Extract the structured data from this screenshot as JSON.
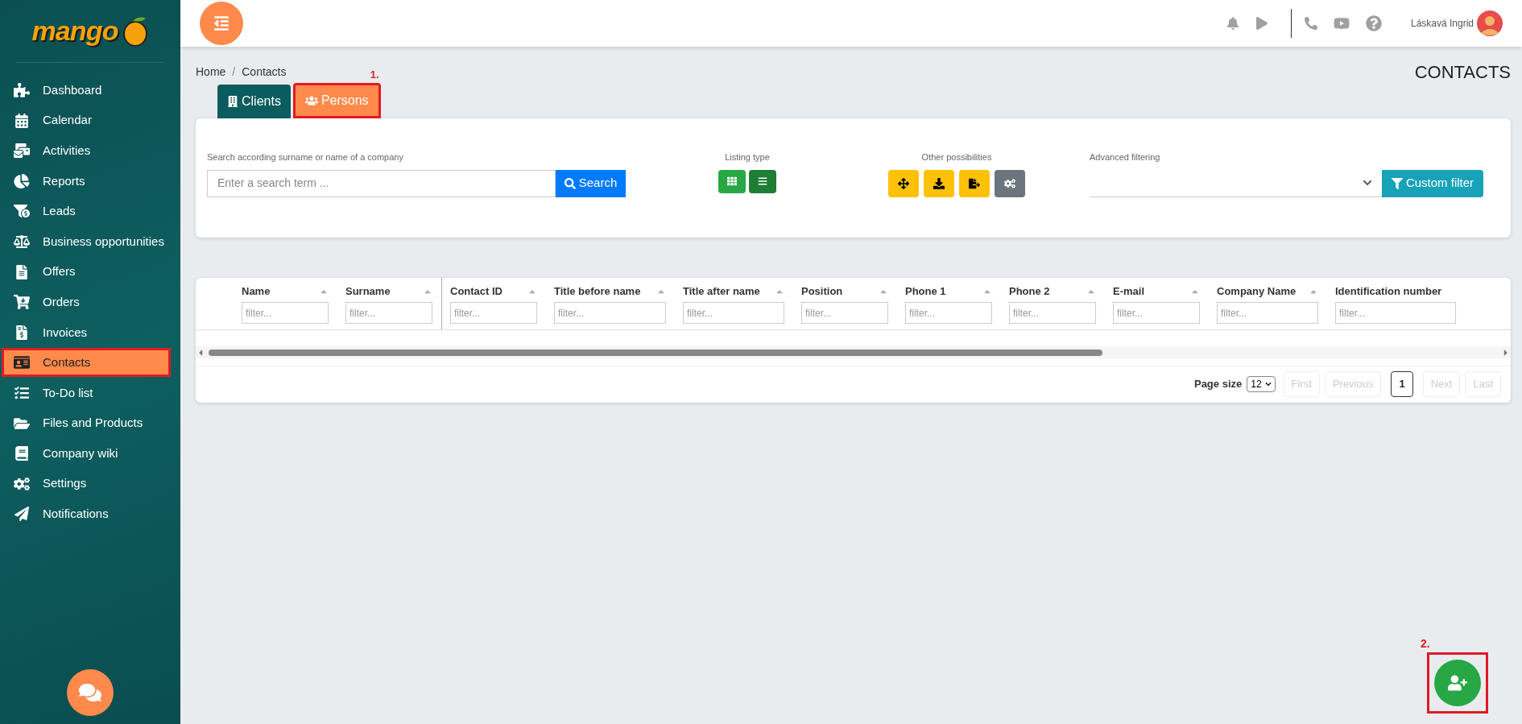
{
  "logo": "mango",
  "sidebar": {
    "items": [
      {
        "label": "Dashboard",
        "selected": false
      },
      {
        "label": "Calendar",
        "selected": false
      },
      {
        "label": "Activities",
        "selected": false
      },
      {
        "label": "Reports",
        "selected": false
      },
      {
        "label": "Leads",
        "selected": false
      },
      {
        "label": "Business opportunities",
        "selected": false
      },
      {
        "label": "Offers",
        "selected": false
      },
      {
        "label": "Orders",
        "selected": false
      },
      {
        "label": "Invoices",
        "selected": false
      },
      {
        "label": "Contacts",
        "selected": true
      },
      {
        "label": "To-Do list",
        "selected": false
      },
      {
        "label": "Files and Products",
        "selected": false
      },
      {
        "label": "Company wiki",
        "selected": false
      },
      {
        "label": "Settings",
        "selected": false
      },
      {
        "label": "Notifications",
        "selected": false
      }
    ]
  },
  "topbar": {
    "user": "Láskavá Ingrid"
  },
  "breadcrumb": [
    "Home",
    "Contacts"
  ],
  "breadcrumb_separator": "/",
  "page_title": "CONTACTS",
  "tabs": [
    {
      "label": "Clients",
      "selected": false
    },
    {
      "label": "Persons",
      "selected": true,
      "annotation": "1."
    }
  ],
  "filters": {
    "search_label": "Search according surname or name of a company",
    "search_placeholder": "Enter a search term ...",
    "search_button": "Search",
    "listing_label": "Listing type",
    "listing_options": [
      {
        "selected": false
      },
      {
        "selected": true
      }
    ],
    "other_label": "Other possibilities",
    "advanced_label": "Advanced filtering",
    "custom_filter_button": "Custom filter"
  },
  "table": {
    "columns": [
      {
        "label": "Name",
        "placeholder": "filter..."
      },
      {
        "label": "Surname",
        "placeholder": "filter..."
      },
      {
        "label": "Contact ID",
        "placeholder": "filter..."
      },
      {
        "label": "Title before name",
        "placeholder": "filter..."
      },
      {
        "label": "Title after name",
        "placeholder": "filter..."
      },
      {
        "label": "Position",
        "placeholder": "filter..."
      },
      {
        "label": "Phone 1",
        "placeholder": "filter..."
      },
      {
        "label": "Phone 2",
        "placeholder": "filter..."
      },
      {
        "label": "E-mail",
        "placeholder": "filter..."
      },
      {
        "label": "Company Name",
        "placeholder": "filter..."
      },
      {
        "label": "Identification number",
        "placeholder": "filter..."
      }
    ]
  },
  "pagination": {
    "page_size_label": "Page size",
    "page_size": "12",
    "buttons": [
      {
        "label": "First",
        "disabled": true,
        "selected": false
      },
      {
        "label": "Previous",
        "disabled": true,
        "selected": false
      },
      {
        "label": "1",
        "disabled": false,
        "selected": true
      },
      {
        "label": "Next",
        "disabled": true,
        "selected": false
      },
      {
        "label": "Last",
        "disabled": true,
        "selected": false
      }
    ]
  },
  "add_button": {
    "annotation": "2."
  }
}
